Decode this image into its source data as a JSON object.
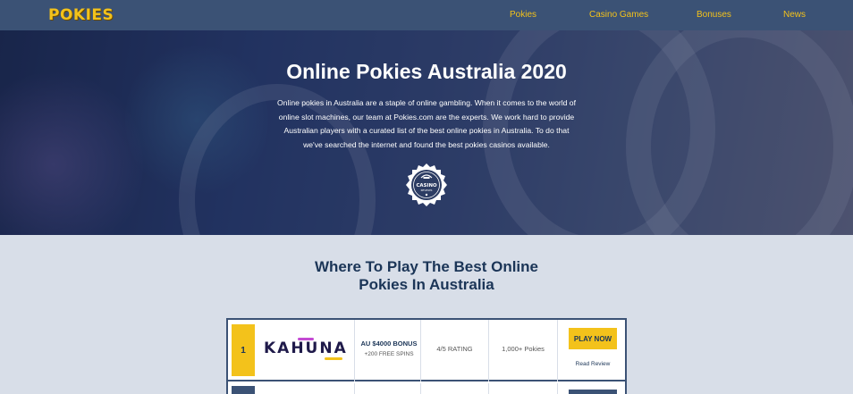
{
  "nav": {
    "logo": "POKIES",
    "links": [
      "Pokies",
      "Casino Games",
      "Bonuses",
      "News"
    ]
  },
  "hero": {
    "title": "Online Pokies Australia 2020",
    "lines": [
      "Online pokies in Australia are a staple of online gambling. When it comes to the world of",
      "online slot machines, our team at Pokies.com are the experts. We work hard to provide",
      "Australian players with a curated list of the best online pokies in Australia. To do that",
      "we've searched the internet and found the best pokies casinos available."
    ],
    "badge": {
      "main": "CASINO",
      "sub": "REVIEWS"
    }
  },
  "section": {
    "title_line1": "Where To Play The Best Online",
    "title_line2": "Pokies In Australia"
  },
  "casinos": [
    {
      "rank": "1",
      "brand": "KAHUNA",
      "bonus": "AU $4000 BONUS",
      "spins": "+200 FREE SPINS",
      "rating": "4/5 RATING",
      "pokies": "1,000+ Pokies",
      "cta": "PLAY NOW",
      "review": "Read Review"
    }
  ],
  "colors": {
    "nav_bg": "#3b5275",
    "accent": "#f3c21b",
    "heading": "#1b3557",
    "page_bg": "#d8dee8"
  }
}
